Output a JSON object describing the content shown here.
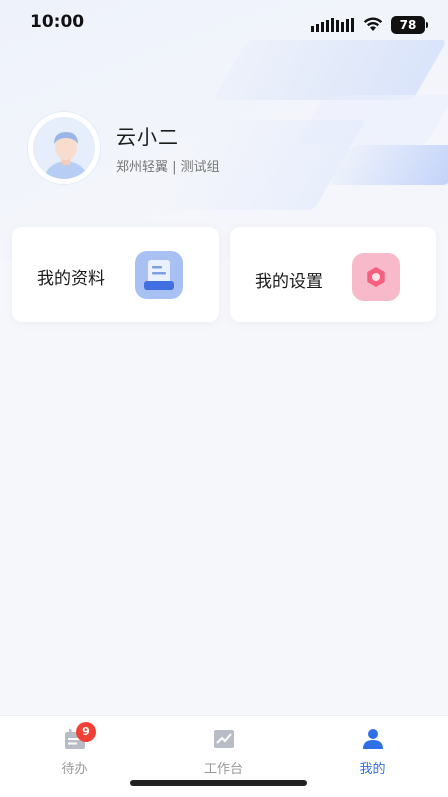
{
  "status_bar": {
    "time": "10:00",
    "battery": "78"
  },
  "profile": {
    "name": "云小二",
    "org": "郑州轻翼 | 测试组"
  },
  "cards": [
    {
      "label": "我的资料",
      "icon": "document-icon"
    },
    {
      "label": "我的设置",
      "icon": "gear-icon"
    }
  ],
  "tab_bar": {
    "items": [
      {
        "label": "待办",
        "icon": "todo-calendar-icon",
        "badge": "9",
        "active": false
      },
      {
        "label": "工作台",
        "icon": "chart-trend-icon",
        "active": false
      },
      {
        "label": "我的",
        "icon": "user-icon",
        "active": true
      }
    ]
  },
  "colors": {
    "accent": "#2f6fe8",
    "badge": "#f04134",
    "profile_icon_bg": "#a9c1f2",
    "settings_icon_bg": "#f8b9cb"
  }
}
